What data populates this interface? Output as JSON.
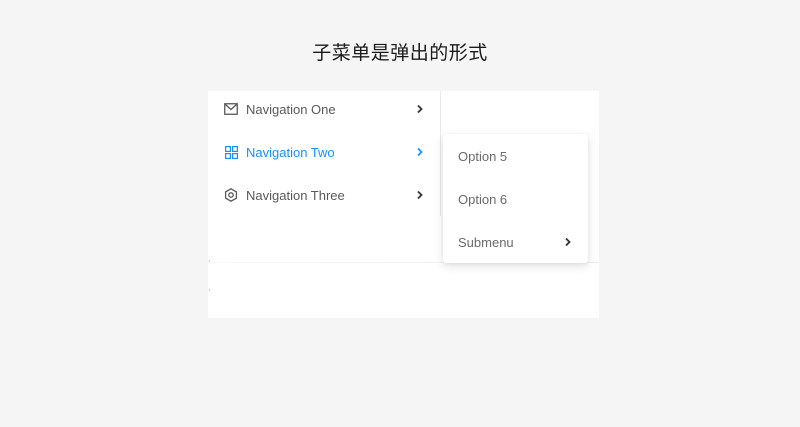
{
  "caption": "子菜单是弹出的形式",
  "colors": {
    "active": "#1890ff",
    "text": "#595959",
    "background": "#f5f5f5"
  },
  "menu": {
    "items": [
      {
        "label": "Navigation One",
        "icon": "mail-icon",
        "active": false
      },
      {
        "label": "Navigation Two",
        "icon": "appstore-icon",
        "active": true
      },
      {
        "label": "Navigation Three",
        "icon": "setting-icon",
        "active": false
      }
    ]
  },
  "submenu": {
    "items": [
      {
        "label": "Option 5"
      },
      {
        "label": "Option 6"
      },
      {
        "label": "Submenu",
        "has_children": true
      }
    ]
  }
}
